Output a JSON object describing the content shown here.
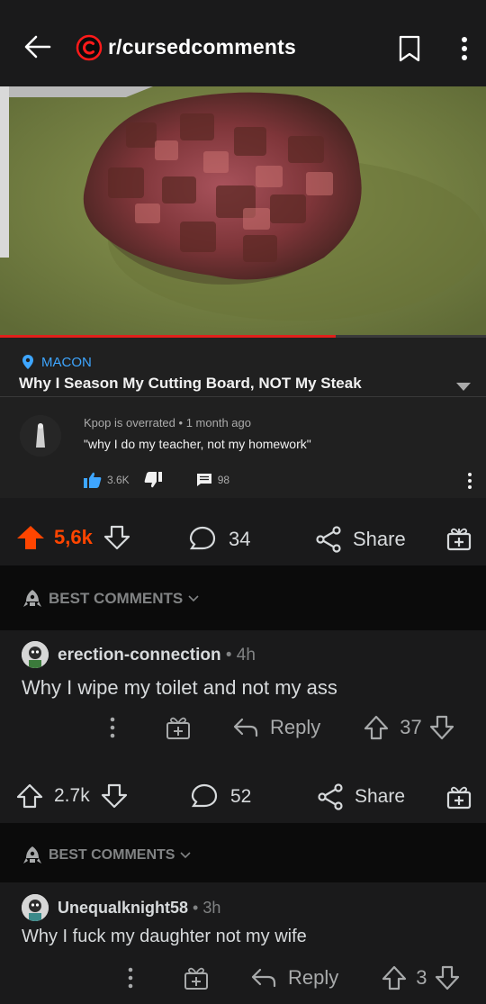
{
  "header": {
    "subreddit": "r/cursedcomments"
  },
  "video": {
    "location": "MACON",
    "title": "Why I Season My Cutting Board, NOT My Steak",
    "progress_fraction": 0.69,
    "comment": {
      "author": "Kpop is overrated",
      "separator": "•",
      "time": "1 month ago",
      "text": "\"why I do my teacher, not my homework\"",
      "likes": "3.6K",
      "replies": "98"
    }
  },
  "post_actions": {
    "score": "5,6k",
    "comments": "34",
    "share": "Share"
  },
  "best_comments_label": "BEST COMMENTS",
  "comments": [
    {
      "user": "erection-connection",
      "sep": " • ",
      "time": "4h",
      "text": "Why I wipe my toilet and not my ass",
      "reply": "Reply",
      "score": "37"
    },
    {
      "user": "Unequalknight58",
      "sep": " • ",
      "time": "3h",
      "text": "Why I fuck my daughter not my wife",
      "reply": "Reply",
      "score": "3"
    }
  ],
  "post_actions_2": {
    "score": "2.7k",
    "comments": "52",
    "share": "Share"
  },
  "colors": {
    "upvoted": "#ff4500",
    "link": "#3ea6ff",
    "progress": "#e0201b",
    "background": "#0b0b0b",
    "card": "#1a1a1b"
  }
}
